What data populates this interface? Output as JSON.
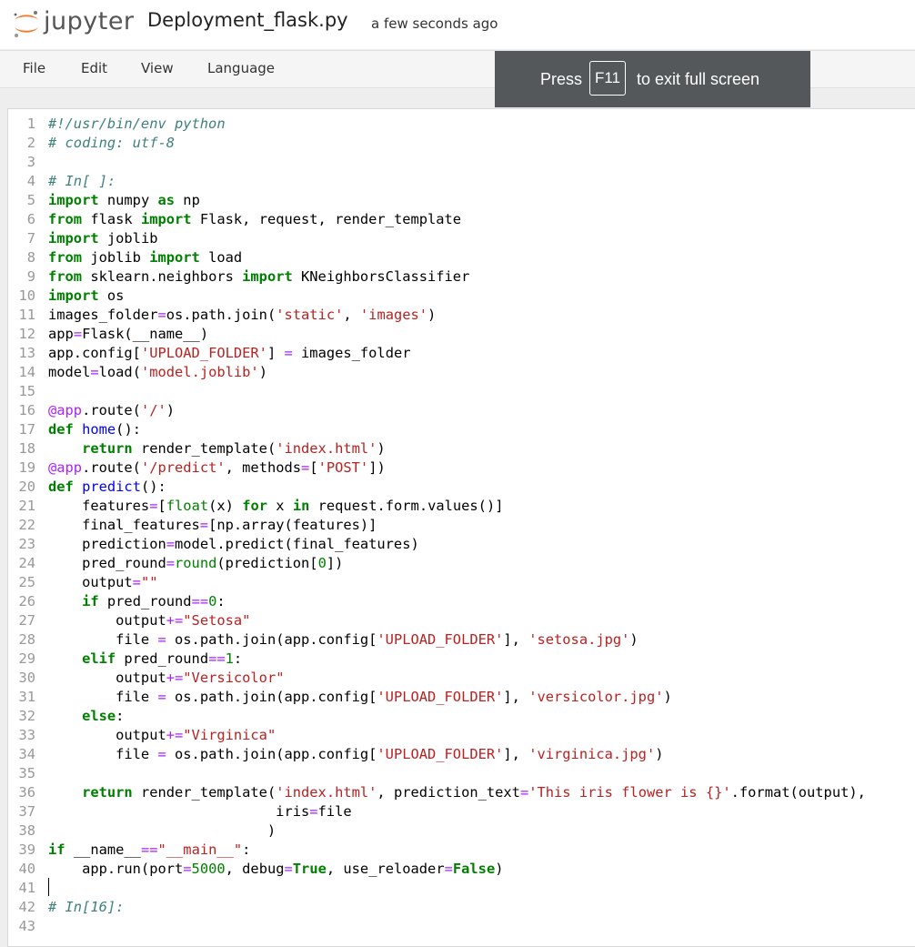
{
  "header": {
    "logo_text": "jupyter",
    "notebook_name": "Deployment_flask.py",
    "save_status": "a few seconds ago"
  },
  "menubar": {
    "items": [
      "File",
      "Edit",
      "View",
      "Language"
    ]
  },
  "fullscreen_toast": {
    "press_text": "Press",
    "key_label": "F11",
    "exit_text": "to exit full screen"
  },
  "editor": {
    "lines": [
      {
        "n": "1",
        "t": [
          [
            "cm",
            "#!/usr/bin/env python"
          ]
        ]
      },
      {
        "n": "2",
        "t": [
          [
            "cm",
            "# coding: utf-8"
          ]
        ]
      },
      {
        "n": "3",
        "t": []
      },
      {
        "n": "4",
        "t": [
          [
            "cm",
            "# In[ ]:"
          ]
        ]
      },
      {
        "n": "5",
        "t": [
          [
            "kw",
            "import"
          ],
          [
            "",
            " numpy "
          ],
          [
            "kw",
            "as"
          ],
          [
            "",
            " np"
          ]
        ]
      },
      {
        "n": "6",
        "t": [
          [
            "kw",
            "from"
          ],
          [
            "",
            " flask "
          ],
          [
            "kw",
            "import"
          ],
          [
            "",
            " Flask, request, render_template"
          ]
        ]
      },
      {
        "n": "7",
        "t": [
          [
            "kw",
            "import"
          ],
          [
            "",
            " joblib"
          ]
        ]
      },
      {
        "n": "8",
        "t": [
          [
            "kw",
            "from"
          ],
          [
            "",
            " joblib "
          ],
          [
            "kw",
            "import"
          ],
          [
            "",
            " load"
          ]
        ]
      },
      {
        "n": "9",
        "t": [
          [
            "kw",
            "from"
          ],
          [
            "",
            " sklearn.neighbors "
          ],
          [
            "kw",
            "import"
          ],
          [
            "",
            " KNeighborsClassifier"
          ]
        ]
      },
      {
        "n": "10",
        "t": [
          [
            "kw",
            "import"
          ],
          [
            "",
            " os"
          ]
        ]
      },
      {
        "n": "11",
        "t": [
          [
            "",
            "images_folder"
          ],
          [
            "op",
            "="
          ],
          [
            "",
            "os.path.join("
          ],
          [
            "str",
            "'static'"
          ],
          [
            "",
            ", "
          ],
          [
            "str",
            "'images'"
          ],
          [
            "",
            ")"
          ]
        ]
      },
      {
        "n": "12",
        "t": [
          [
            "",
            "app"
          ],
          [
            "op",
            "="
          ],
          [
            "",
            "Flask(__name__)"
          ]
        ]
      },
      {
        "n": "13",
        "t": [
          [
            "",
            "app.config["
          ],
          [
            "str",
            "'UPLOAD_FOLDER'"
          ],
          [
            "",
            "] "
          ],
          [
            "op",
            "="
          ],
          [
            "",
            " images_folder"
          ]
        ]
      },
      {
        "n": "14",
        "t": [
          [
            "",
            "model"
          ],
          [
            "op",
            "="
          ],
          [
            "",
            "load("
          ],
          [
            "str",
            "'model.joblib'"
          ],
          [
            "",
            ")"
          ]
        ]
      },
      {
        "n": "15",
        "t": []
      },
      {
        "n": "16",
        "t": [
          [
            "op",
            "@app"
          ],
          [
            "",
            ".route("
          ],
          [
            "str",
            "'/'"
          ],
          [
            "",
            ")"
          ]
        ]
      },
      {
        "n": "17",
        "t": [
          [
            "kw",
            "def"
          ],
          [
            "",
            " "
          ],
          [
            "def",
            "home"
          ],
          [
            "",
            "():"
          ]
        ]
      },
      {
        "n": "18",
        "t": [
          [
            "",
            "    "
          ],
          [
            "kw",
            "return"
          ],
          [
            "",
            " render_template("
          ],
          [
            "str",
            "'index.html'"
          ],
          [
            "",
            ")"
          ]
        ]
      },
      {
        "n": "19",
        "t": [
          [
            "op",
            "@app"
          ],
          [
            "",
            ".route("
          ],
          [
            "str",
            "'/predict'"
          ],
          [
            "",
            ", methods"
          ],
          [
            "op",
            "="
          ],
          [
            "",
            "["
          ],
          [
            "str",
            "'POST'"
          ],
          [
            "",
            "])"
          ]
        ]
      },
      {
        "n": "20",
        "t": [
          [
            "kw",
            "def"
          ],
          [
            "",
            " "
          ],
          [
            "def",
            "predict"
          ],
          [
            "",
            "():"
          ]
        ]
      },
      {
        "n": "21",
        "t": [
          [
            "",
            "    features"
          ],
          [
            "op",
            "="
          ],
          [
            "",
            "["
          ],
          [
            "bi",
            "float"
          ],
          [
            "",
            "(x) "
          ],
          [
            "kw",
            "for"
          ],
          [
            "",
            " x "
          ],
          [
            "kw",
            "in"
          ],
          [
            "",
            " request.form.values()]"
          ]
        ]
      },
      {
        "n": "22",
        "t": [
          [
            "",
            "    final_features"
          ],
          [
            "op",
            "="
          ],
          [
            "",
            "[np.array(features)]"
          ]
        ]
      },
      {
        "n": "23",
        "t": [
          [
            "",
            "    prediction"
          ],
          [
            "op",
            "="
          ],
          [
            "",
            "model.predict(final_features)"
          ]
        ]
      },
      {
        "n": "24",
        "t": [
          [
            "",
            "    pred_round"
          ],
          [
            "op",
            "="
          ],
          [
            "bi",
            "round"
          ],
          [
            "",
            "(prediction["
          ],
          [
            "num",
            "0"
          ],
          [
            "",
            "])"
          ]
        ]
      },
      {
        "n": "25",
        "t": [
          [
            "",
            "    output"
          ],
          [
            "op",
            "="
          ],
          [
            "str",
            "\"\""
          ]
        ]
      },
      {
        "n": "26",
        "t": [
          [
            "",
            "    "
          ],
          [
            "kw",
            "if"
          ],
          [
            "",
            " pred_round"
          ],
          [
            "op",
            "=="
          ],
          [
            "num",
            "0"
          ],
          [
            "",
            ":"
          ]
        ]
      },
      {
        "n": "27",
        "t": [
          [
            "",
            "        output"
          ],
          [
            "op",
            "+="
          ],
          [
            "str",
            "\"Setosa\""
          ]
        ]
      },
      {
        "n": "28",
        "t": [
          [
            "",
            "        file "
          ],
          [
            "op",
            "="
          ],
          [
            "",
            " os.path.join(app.config["
          ],
          [
            "str",
            "'UPLOAD_FOLDER'"
          ],
          [
            "",
            "], "
          ],
          [
            "str",
            "'setosa.jpg'"
          ],
          [
            "",
            ")"
          ]
        ]
      },
      {
        "n": "29",
        "t": [
          [
            "",
            "    "
          ],
          [
            "kw",
            "elif"
          ],
          [
            "",
            " pred_round"
          ],
          [
            "op",
            "=="
          ],
          [
            "num",
            "1"
          ],
          [
            "",
            ":"
          ]
        ]
      },
      {
        "n": "30",
        "t": [
          [
            "",
            "        output"
          ],
          [
            "op",
            "+="
          ],
          [
            "str",
            "\"Versicolor\""
          ]
        ]
      },
      {
        "n": "31",
        "t": [
          [
            "",
            "        file "
          ],
          [
            "op",
            "="
          ],
          [
            "",
            " os.path.join(app.config["
          ],
          [
            "str",
            "'UPLOAD_FOLDER'"
          ],
          [
            "",
            "], "
          ],
          [
            "str",
            "'versicolor.jpg'"
          ],
          [
            "",
            ")"
          ]
        ]
      },
      {
        "n": "32",
        "t": [
          [
            "",
            "    "
          ],
          [
            "kw",
            "else"
          ],
          [
            "",
            ":"
          ]
        ]
      },
      {
        "n": "33",
        "t": [
          [
            "",
            "        output"
          ],
          [
            "op",
            "+="
          ],
          [
            "str",
            "\"Virginica\""
          ]
        ]
      },
      {
        "n": "34",
        "t": [
          [
            "",
            "        file "
          ],
          [
            "op",
            "="
          ],
          [
            "",
            " os.path.join(app.config["
          ],
          [
            "str",
            "'UPLOAD_FOLDER'"
          ],
          [
            "",
            "], "
          ],
          [
            "str",
            "'virginica.jpg'"
          ],
          [
            "",
            ")"
          ]
        ]
      },
      {
        "n": "35",
        "t": []
      },
      {
        "n": "36",
        "t": [
          [
            "",
            "    "
          ],
          [
            "kw",
            "return"
          ],
          [
            "",
            " render_template("
          ],
          [
            "str",
            "'index.html'"
          ],
          [
            "",
            ", prediction_text"
          ],
          [
            "op",
            "="
          ],
          [
            "str",
            "'This iris flower is {}'"
          ],
          [
            "",
            ".format(output),"
          ]
        ]
      },
      {
        "n": "37",
        "t": [
          [
            "",
            "                           iris"
          ],
          [
            "op",
            "="
          ],
          [
            "",
            "file"
          ]
        ]
      },
      {
        "n": "38",
        "t": [
          [
            "",
            "                          )"
          ]
        ]
      },
      {
        "n": "39",
        "t": [
          [
            "kw",
            "if"
          ],
          [
            "",
            " __name__"
          ],
          [
            "op",
            "=="
          ],
          [
            "str",
            "\"__main__\""
          ],
          [
            "",
            ":"
          ]
        ]
      },
      {
        "n": "40",
        "t": [
          [
            "",
            "    app.run(port"
          ],
          [
            "op",
            "="
          ],
          [
            "num",
            "5000"
          ],
          [
            "",
            ", debug"
          ],
          [
            "op",
            "="
          ],
          [
            "kw",
            "True"
          ],
          [
            "",
            ", use_reloader"
          ],
          [
            "op",
            "="
          ],
          [
            "kw",
            "False"
          ],
          [
            "",
            ")"
          ]
        ]
      },
      {
        "n": "41",
        "t": []
      },
      {
        "n": "42",
        "t": [
          [
            "cm",
            "# In[16]:"
          ]
        ]
      },
      {
        "n": "43",
        "t": []
      }
    ]
  }
}
